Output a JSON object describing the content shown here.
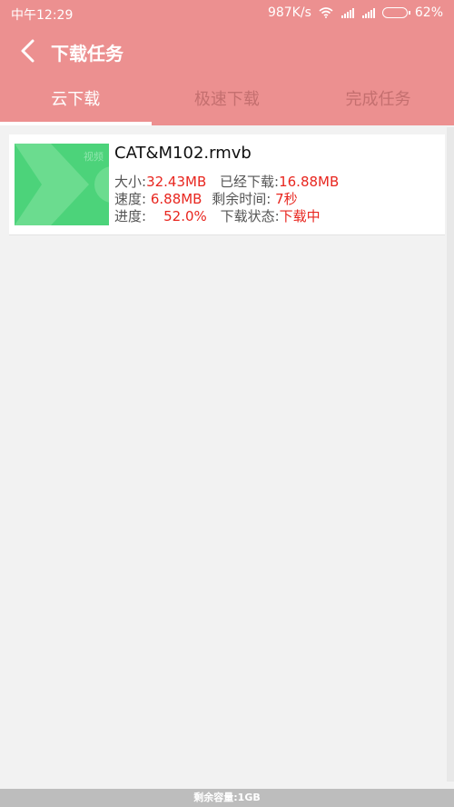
{
  "status": {
    "time": "中午12:29",
    "speed": "987K/s",
    "battery": "62%"
  },
  "header": {
    "title": "下载任务"
  },
  "tabs": [
    {
      "label": "云下载",
      "active": true
    },
    {
      "label": "极速下载",
      "active": false
    },
    {
      "label": "完成任务",
      "active": false
    }
  ],
  "task": {
    "thumb_tag": "视频",
    "file_name": "CAT&M102.rmvb",
    "size_label": "大小:",
    "size_value": "32.43MB",
    "downloaded_label": "已经下载:",
    "downloaded_value": "16.88MB",
    "speed_label": "速度:",
    "speed_value": "6.88MB",
    "remaining_label": "剩余时间:",
    "remaining_value": "7秒",
    "progress_label": "进度:",
    "progress_value": "52.0%",
    "state_label": "下载状态:",
    "state_value": "下载中"
  },
  "footer": {
    "storage": "剩余容量:1GB"
  },
  "colors": {
    "header_bg": "#ec9090",
    "accent_red": "#e8261f",
    "thumb_green": "#4cd37a"
  }
}
